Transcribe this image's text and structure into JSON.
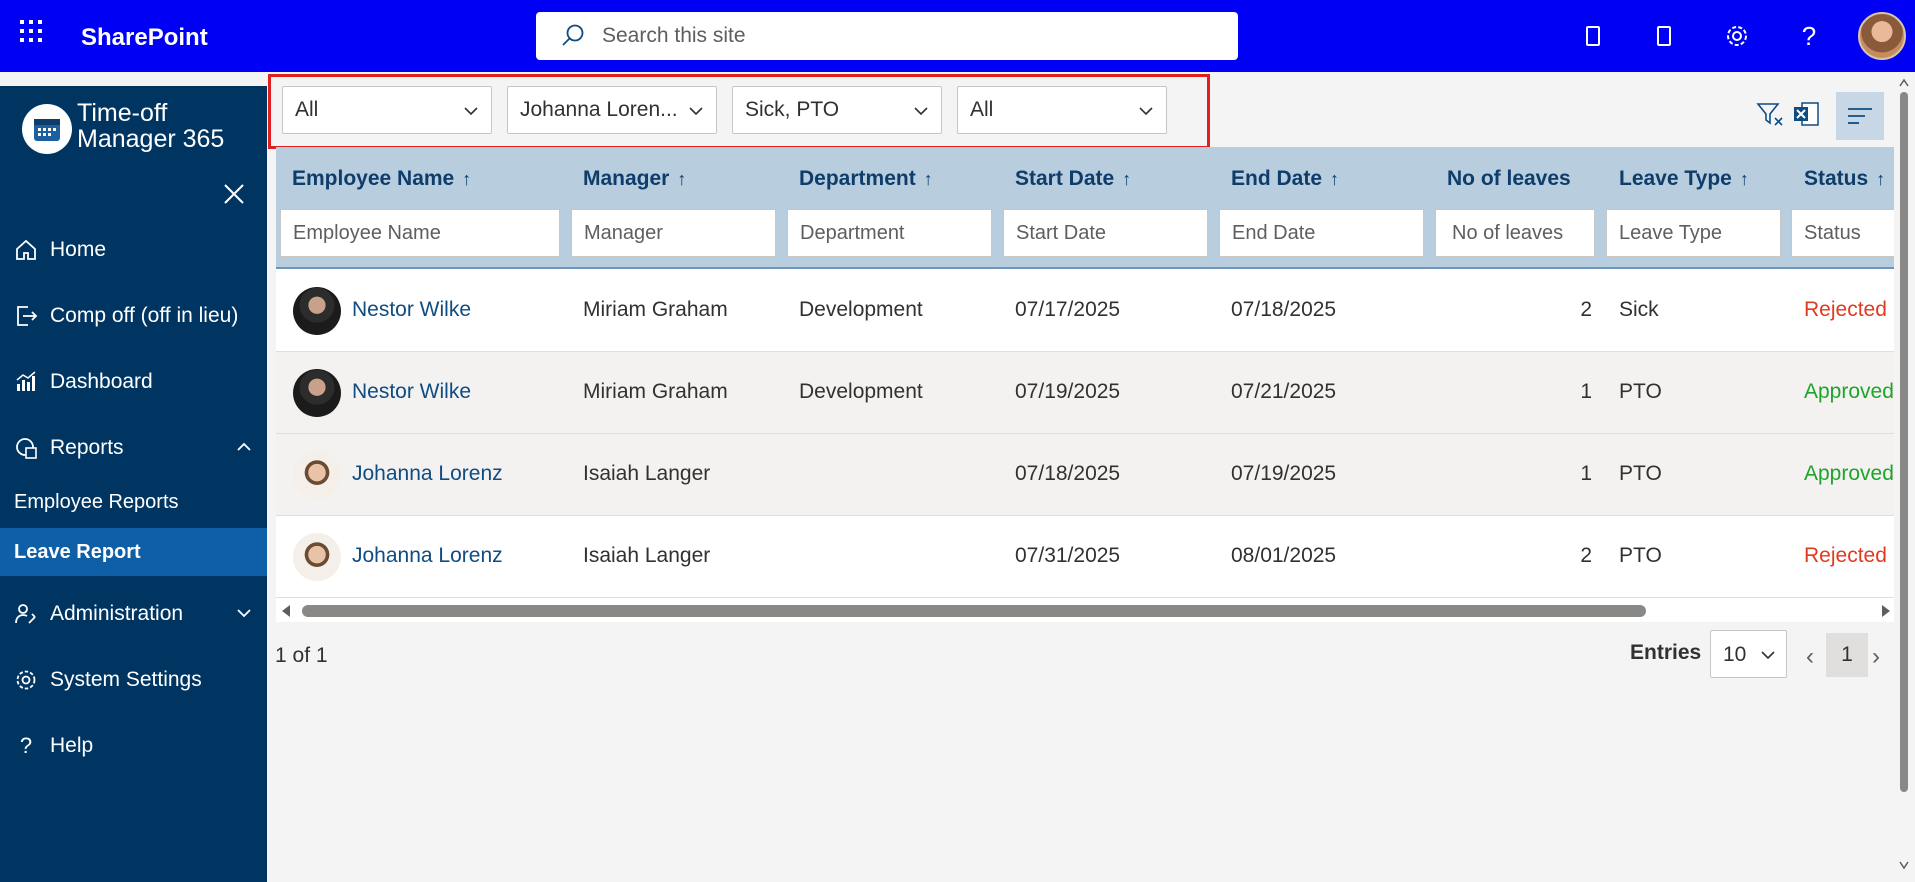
{
  "suitebar": {
    "brand": "SharePoint",
    "search_placeholder": "Search this site"
  },
  "sidebar": {
    "app_title_line1": "Time-off",
    "app_title_line2": "Manager 365",
    "items": [
      {
        "label": "Home"
      },
      {
        "label": "Comp off (off in lieu)"
      },
      {
        "label": "Dashboard"
      },
      {
        "label": "Reports"
      },
      {
        "label": "Employee Reports"
      },
      {
        "label": "Leave Report"
      },
      {
        "label": "Administration"
      },
      {
        "label": "System Settings"
      },
      {
        "label": "Help"
      }
    ]
  },
  "filters": {
    "department": "All",
    "employee": "Johanna Loren...",
    "leave_type": "Sick, PTO",
    "status": "All"
  },
  "table": {
    "headers": [
      "Employee Name",
      "Manager",
      "Department",
      "Start Date",
      "End Date",
      "No of leaves",
      "Leave Type",
      "Status"
    ],
    "sort_arrow": "↑",
    "filter_placeholders": [
      "Employee Name",
      "Manager",
      "Department",
      "Start Date",
      "End Date",
      "No of leaves",
      "Leave Type",
      "Status"
    ],
    "rows": [
      {
        "employee": "Nestor Wilke",
        "manager": "Miriam Graham",
        "department": "Development",
        "start": "07/17/2025",
        "end": "07/18/2025",
        "leaves": "2",
        "type": "Sick",
        "status": "Rejected"
      },
      {
        "employee": "Nestor Wilke",
        "manager": "Miriam Graham",
        "department": "Development",
        "start": "07/19/2025",
        "end": "07/21/2025",
        "leaves": "1",
        "type": "PTO",
        "status": "Approved"
      },
      {
        "employee": "Johanna Lorenz",
        "manager": "Isaiah Langer",
        "department": "",
        "start": "07/18/2025",
        "end": "07/19/2025",
        "leaves": "1",
        "type": "PTO",
        "status": "Approved"
      },
      {
        "employee": "Johanna Lorenz",
        "manager": "Isaiah Langer",
        "department": "",
        "start": "07/31/2025",
        "end": "08/01/2025",
        "leaves": "2",
        "type": "PTO",
        "status": "Rejected"
      }
    ]
  },
  "pager": {
    "summary": "1 of 1",
    "entries_label": "Entries",
    "entries_value": "10",
    "current_page": "1"
  },
  "colors": {
    "suitebar": "#0000f5",
    "sidebar": "#003562",
    "sidebar_active": "#0f5fa6",
    "header": "#b8cddd",
    "rejected": "#e03b1f",
    "approved": "#1fa32a",
    "highlight_box": "#e02020"
  },
  "icons": [
    "waffle-icon",
    "search-icon",
    "phone-icon",
    "tablet-icon",
    "settings-icon",
    "help-icon",
    "calendar-logo-icon",
    "close-icon",
    "home-icon",
    "exit-icon",
    "chart-icon",
    "report-icon",
    "chevron-up-icon",
    "admin-icon",
    "chevron-down-icon",
    "gear-icon",
    "question-icon",
    "clear-filter-icon",
    "excel-icon",
    "view-options-icon"
  ]
}
